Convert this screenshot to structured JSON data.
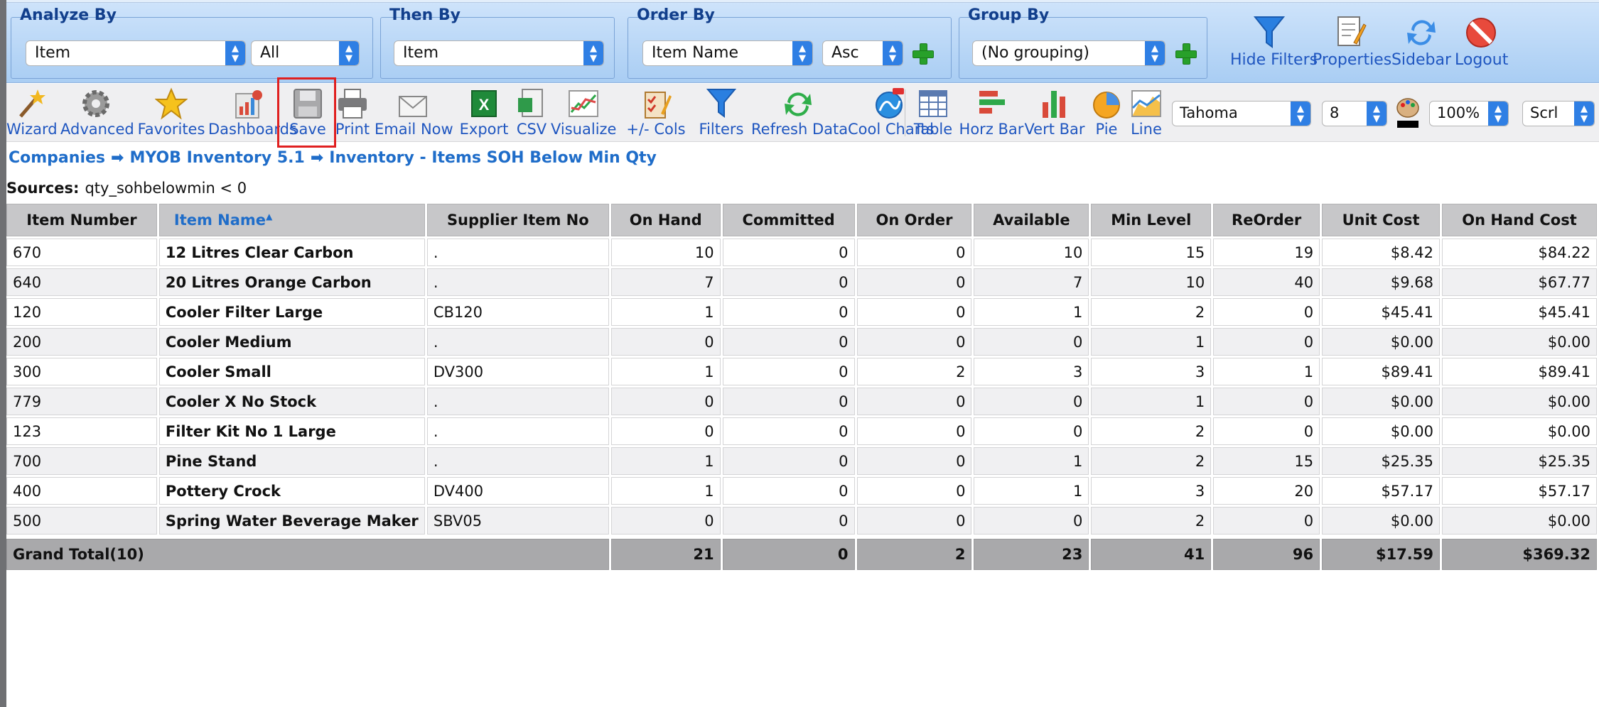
{
  "analyze_by": {
    "label": "Analyze By",
    "field": "Item",
    "filter": "All"
  },
  "then_by": {
    "label": "Then By",
    "field": "Item"
  },
  "order_by": {
    "label": "Order By",
    "field": "Item Name",
    "direction": "Asc"
  },
  "group_by": {
    "label": "Group By",
    "field": "(No grouping)"
  },
  "top_actions": {
    "hide_filters": "Hide Filters",
    "properties": "Properties",
    "sidebar": "Sidebar",
    "logout": "Logout"
  },
  "toolbar": {
    "wizard": "Wizard",
    "advanced": "Advanced",
    "favorites": "Favorites",
    "dashboards": "Dashboards",
    "save": "Save",
    "print": "Print",
    "email_now": "Email Now",
    "export": "Export",
    "csv": "CSV",
    "visualize": "Visualize",
    "cols": "+/- Cols",
    "filters": "Filters",
    "refresh": "Refresh Data",
    "cool_charts": "Cool Charts",
    "table": "Table",
    "horz_bar": "Horz Bar",
    "vert_bar": "Vert Bar",
    "pie": "Pie",
    "line": "Line",
    "font": "Tahoma",
    "font_size": "8",
    "zoom": "100%",
    "scroll": "Scrl"
  },
  "breadcrumb": {
    "items": [
      "Companies",
      "MYOB Inventory 5.1",
      "Inventory - Items SOH Below Min Qty"
    ],
    "separator": "➡"
  },
  "sources": {
    "label": "Sources:",
    "value": "qty_sohbelowmin < 0"
  },
  "table": {
    "columns": [
      "Item Number",
      "Item Name",
      "Supplier Item No",
      "On Hand",
      "Committed",
      "On Order",
      "Available",
      "Min Level",
      "ReOrder",
      "Unit Cost",
      "On Hand Cost"
    ],
    "rows": [
      [
        "670",
        "12 Litres Clear Carbon",
        ".",
        "10",
        "0",
        "0",
        "10",
        "15",
        "19",
        "$8.42",
        "$84.22"
      ],
      [
        "640",
        "20 Litres Orange Carbon",
        ".",
        "7",
        "0",
        "0",
        "7",
        "10",
        "40",
        "$9.68",
        "$67.77"
      ],
      [
        "120",
        "Cooler Filter Large",
        "CB120",
        "1",
        "0",
        "0",
        "1",
        "2",
        "0",
        "$45.41",
        "$45.41"
      ],
      [
        "200",
        "Cooler Medium",
        ".",
        "0",
        "0",
        "0",
        "0",
        "1",
        "0",
        "$0.00",
        "$0.00"
      ],
      [
        "300",
        "Cooler Small",
        "DV300",
        "1",
        "0",
        "2",
        "3",
        "3",
        "1",
        "$89.41",
        "$89.41"
      ],
      [
        "779",
        "Cooler X No Stock",
        ".",
        "0",
        "0",
        "0",
        "0",
        "1",
        "0",
        "$0.00",
        "$0.00"
      ],
      [
        "123",
        "Filter Kit No 1 Large",
        ".",
        "0",
        "0",
        "0",
        "0",
        "2",
        "0",
        "$0.00",
        "$0.00"
      ],
      [
        "700",
        "Pine Stand",
        ".",
        "1",
        "0",
        "0",
        "1",
        "2",
        "15",
        "$25.35",
        "$25.35"
      ],
      [
        "400",
        "Pottery Crock",
        "DV400",
        "1",
        "0",
        "0",
        "1",
        "3",
        "20",
        "$57.17",
        "$57.17"
      ],
      [
        "500",
        "Spring Water Beverage Maker",
        "SBV05",
        "0",
        "0",
        "0",
        "0",
        "2",
        "0",
        "$0.00",
        "$0.00"
      ]
    ],
    "total": [
      "Grand Total(10)",
      "21",
      "0",
      "2",
      "23",
      "41",
      "96",
      "$17.59",
      "$369.32"
    ]
  }
}
